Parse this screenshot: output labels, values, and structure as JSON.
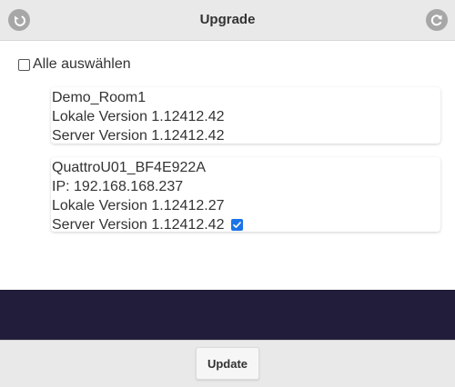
{
  "header": {
    "title": "Upgrade",
    "back_icon": "back-arrow-icon",
    "refresh_icon": "refresh-icon"
  },
  "select_all": {
    "label": "Alle auswählen",
    "checked": false
  },
  "devices": [
    {
      "name": "Demo_Room1",
      "local_version": "Lokale Version 1.12412.42",
      "server_version": "Server Version 1.12412.42"
    },
    {
      "name": "QuattroU01_BF4E922A",
      "ip": "IP: 192.168.168.237",
      "local_version": "Lokale Version 1.12412.27",
      "server_version": "Server Version 1.12412.42",
      "selected": true
    }
  ],
  "footer": {
    "update_label": "Update"
  },
  "colors": {
    "header_bg": "#e9e9e9",
    "band": "#211d3a",
    "checkbox_accent": "#1a73e8"
  }
}
